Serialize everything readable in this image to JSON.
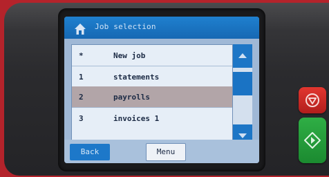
{
  "header": {
    "title": "Job selection",
    "icon": "home-icon"
  },
  "job_list": {
    "rows": [
      {
        "number": "*",
        "name": "New job",
        "selected": false
      },
      {
        "number": "1",
        "name": "statements",
        "selected": false
      },
      {
        "number": "2",
        "name": "payrolls",
        "selected": true
      },
      {
        "number": "3",
        "name": "invoices 1",
        "selected": false
      }
    ]
  },
  "scrollbar": {
    "up_icon": "chevron-up-icon",
    "down_icon": "chevron-down-icon"
  },
  "footer": {
    "back_label": "Back",
    "menu_label": "Menu"
  },
  "hardware_buttons": {
    "stop_icon": "stop-icon",
    "start_icon": "start-icon",
    "stop_color": "#d62b27",
    "start_color": "#25a03b"
  },
  "colors": {
    "titlebar": "#1b74c4",
    "selected_row": "#b2a5a8",
    "screen_bg": "#9fb8d6"
  }
}
